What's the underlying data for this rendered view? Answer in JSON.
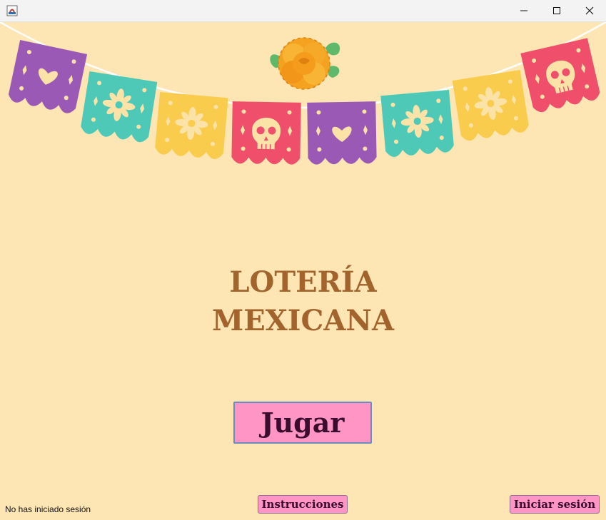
{
  "window": {
    "minimize_icon": "minimize-icon",
    "maximize_icon": "maximize-icon",
    "close_icon": "close-icon"
  },
  "colors": {
    "background": "#fde6b4",
    "title": "#a2642c",
    "button": "#ff95c5",
    "button_text": "#3a0d2e",
    "flag_purple": "#9b59b6",
    "flag_teal": "#4ec9b8",
    "flag_yellow": "#f9cc4e",
    "flag_red": "#ef4f6b",
    "marigold": "#f6a31c"
  },
  "banner": {
    "flags": [
      "heart",
      "flower",
      "flower",
      "skull",
      "heart",
      "flower",
      "flower",
      "skull"
    ],
    "decoration": "marigold-flower"
  },
  "main": {
    "title_line1": "LOTERÍA",
    "title_line2": "MEXICANA",
    "play_label": "Jugar"
  },
  "footer": {
    "status": "No has iniciado sesión",
    "instructions_label": "Instrucciones",
    "login_label": "Iniciar sesión"
  }
}
